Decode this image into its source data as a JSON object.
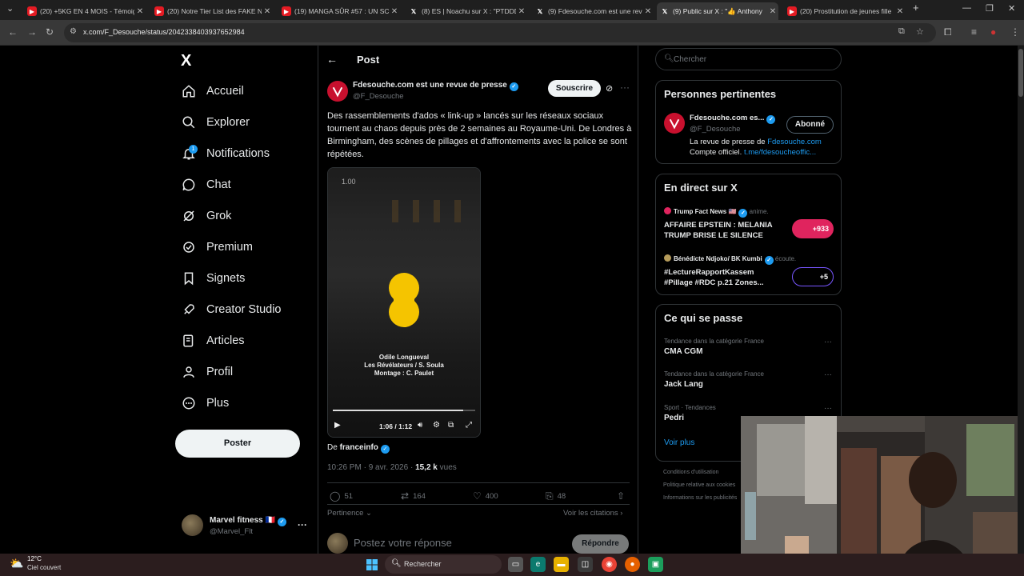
{
  "browser": {
    "tabs": [
      {
        "title": "(20) +5KG EN 4 MOIS - Témoig",
        "icon": "youtube-icon"
      },
      {
        "title": "(20) Notre Tier List des FAKE NA",
        "icon": "youtube-icon"
      },
      {
        "title": "(19) MANGA SÛR #57 : UN SC/",
        "icon": "youtube-icon"
      },
      {
        "title": "(8) ES | Noachu sur X : \"PTDDD",
        "icon": "x-icon"
      },
      {
        "title": "(9) Fdesouche.com est une revu",
        "icon": "x-icon"
      },
      {
        "title": "(9) Public sur X : \"👍 Anthony",
        "icon": "x-icon"
      },
      {
        "title": "(20) Prostitution de jeunes fille",
        "icon": "youtube-icon"
      }
    ],
    "url": "x.com/F_Desouche/status/2042338403937652984"
  },
  "sidebar": {
    "logo": "X",
    "items": [
      {
        "label": "Accueil",
        "icon": "home-icon"
      },
      {
        "label": "Explorer",
        "icon": "search-icon"
      },
      {
        "label": "Notifications",
        "icon": "bell-icon",
        "badge": "1"
      },
      {
        "label": "Chat",
        "icon": "chat-icon"
      },
      {
        "label": "Grok",
        "icon": "grok-icon"
      },
      {
        "label": "Premium",
        "icon": "premium-icon"
      },
      {
        "label": "Signets",
        "icon": "bookmark-icon"
      },
      {
        "label": "Creator Studio",
        "icon": "rocket-icon"
      },
      {
        "label": "Articles",
        "icon": "articles-icon"
      },
      {
        "label": "Profil",
        "icon": "profile-icon"
      },
      {
        "label": "Plus",
        "icon": "more-circle-icon"
      }
    ],
    "post_button": "Poster",
    "account": {
      "name": "Marvel fitness 🇫🇷",
      "handle": "@Marvel_Flt"
    }
  },
  "post": {
    "header_title": "Post",
    "author_name": "Fdesouche.com est une revue de presse",
    "author_handle": "@F_Desouche",
    "subscribe_label": "Souscrire",
    "text": "Des rassemblements d'ados « link-up » lancés sur les réseaux sociaux tournent au chaos depuis  près de 2 semaines au Royaume-Uni. De Londres à Birmingham, des scènes de pillages et d'affrontements avec la police se sont répétées.",
    "video": {
      "speed": "1.00",
      "credit_line1": "Odile Longueval",
      "credit_line2": "Les Révélateurs / S. Soula",
      "credit_line3": "Montage : C. Paulet",
      "time": "1:06 / 1:12",
      "progress": 0.917
    },
    "source_prefix": "De",
    "source_name": "franceinfo",
    "timestamp": "10:26 PM · 9 avr. 2026 · ",
    "views_count": "15,2 k",
    "views_label": " vues",
    "stats": {
      "replies": "51",
      "reposts": "164",
      "likes": "400",
      "bookmarks": "48"
    },
    "relevance_label": "Pertinence",
    "quotes_label": "Voir les citations",
    "reply_placeholder": "Postez votre réponse",
    "reply_button": "Répondre"
  },
  "right": {
    "search_placeholder": "Chercher",
    "relevant": {
      "title": "Personnes pertinentes",
      "name": "Fdesouche.com es...",
      "handle": "@F_Desouche",
      "follow_label": "Abonné",
      "bio_prefix": "La revue de presse de ",
      "bio_link": "Fdesouche.com",
      "bio_line2_prefix": "Compte officiel. ",
      "bio_line2_link": "t.me/fdesoucheoffic..."
    },
    "live": {
      "title": "En direct sur X",
      "items": [
        {
          "host": "Trump Fact News 🇺🇸",
          "action": " anime.",
          "title": "AFFAIRE EPSTEIN : MELANIA TRUMP BRISE LE SILENCE",
          "count": "+933",
          "color": "#e0245e"
        },
        {
          "host": "Bénédicte Ndjoko/ BK Kumbi",
          "action": " écoute.",
          "title": "#LectureRapportKassem #Pillage #RDC p.21 Zones...",
          "count": "+5",
          "color": "#7856ff"
        }
      ]
    },
    "trends": {
      "title": "Ce qui se passe",
      "items": [
        {
          "category": "Tendance dans la catégorie France",
          "name": "CMA CGM"
        },
        {
          "category": "Tendance dans la catégorie France",
          "name": "Jack Lang"
        },
        {
          "category": "Sport · Tendances",
          "name": "Pedri"
        }
      ],
      "see_more": "Voir plus"
    },
    "footer": [
      "Conditions d'utilisation",
      "Politique relative aux cookies",
      "Informations sur les publicités"
    ]
  },
  "taskbar": {
    "temp": "12°C",
    "weather": "Ciel couvert",
    "search_placeholder": "Rechercher"
  },
  "colors": {
    "accent": "#1d9bf0",
    "background": "#000000",
    "border": "#2f3336",
    "muted": "#71767b"
  }
}
